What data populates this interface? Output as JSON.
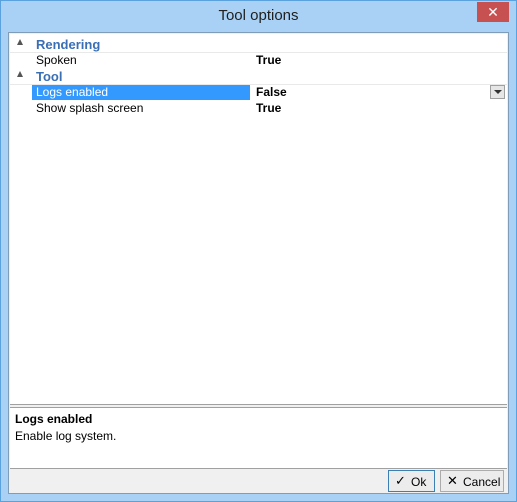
{
  "window": {
    "title": "Tool options",
    "close_glyph": "✕"
  },
  "grid": {
    "categories": [
      {
        "label": "Rendering",
        "properties": [
          {
            "name": "Spoken",
            "value": "True"
          }
        ]
      },
      {
        "label": "Tool",
        "properties": [
          {
            "name": "Logs enabled",
            "value": "False"
          },
          {
            "name": "Show splash screen",
            "value": "True"
          }
        ]
      }
    ]
  },
  "description": {
    "title": "Logs enabled",
    "text": "Enable log system."
  },
  "buttons": {
    "ok_label": "Ok",
    "ok_icon": "✓",
    "cancel_label": "Cancel",
    "cancel_icon": "✕"
  },
  "colors": {
    "selection": "#3399ff",
    "category_text": "#3a6fb4",
    "close_button": "#c75050"
  }
}
